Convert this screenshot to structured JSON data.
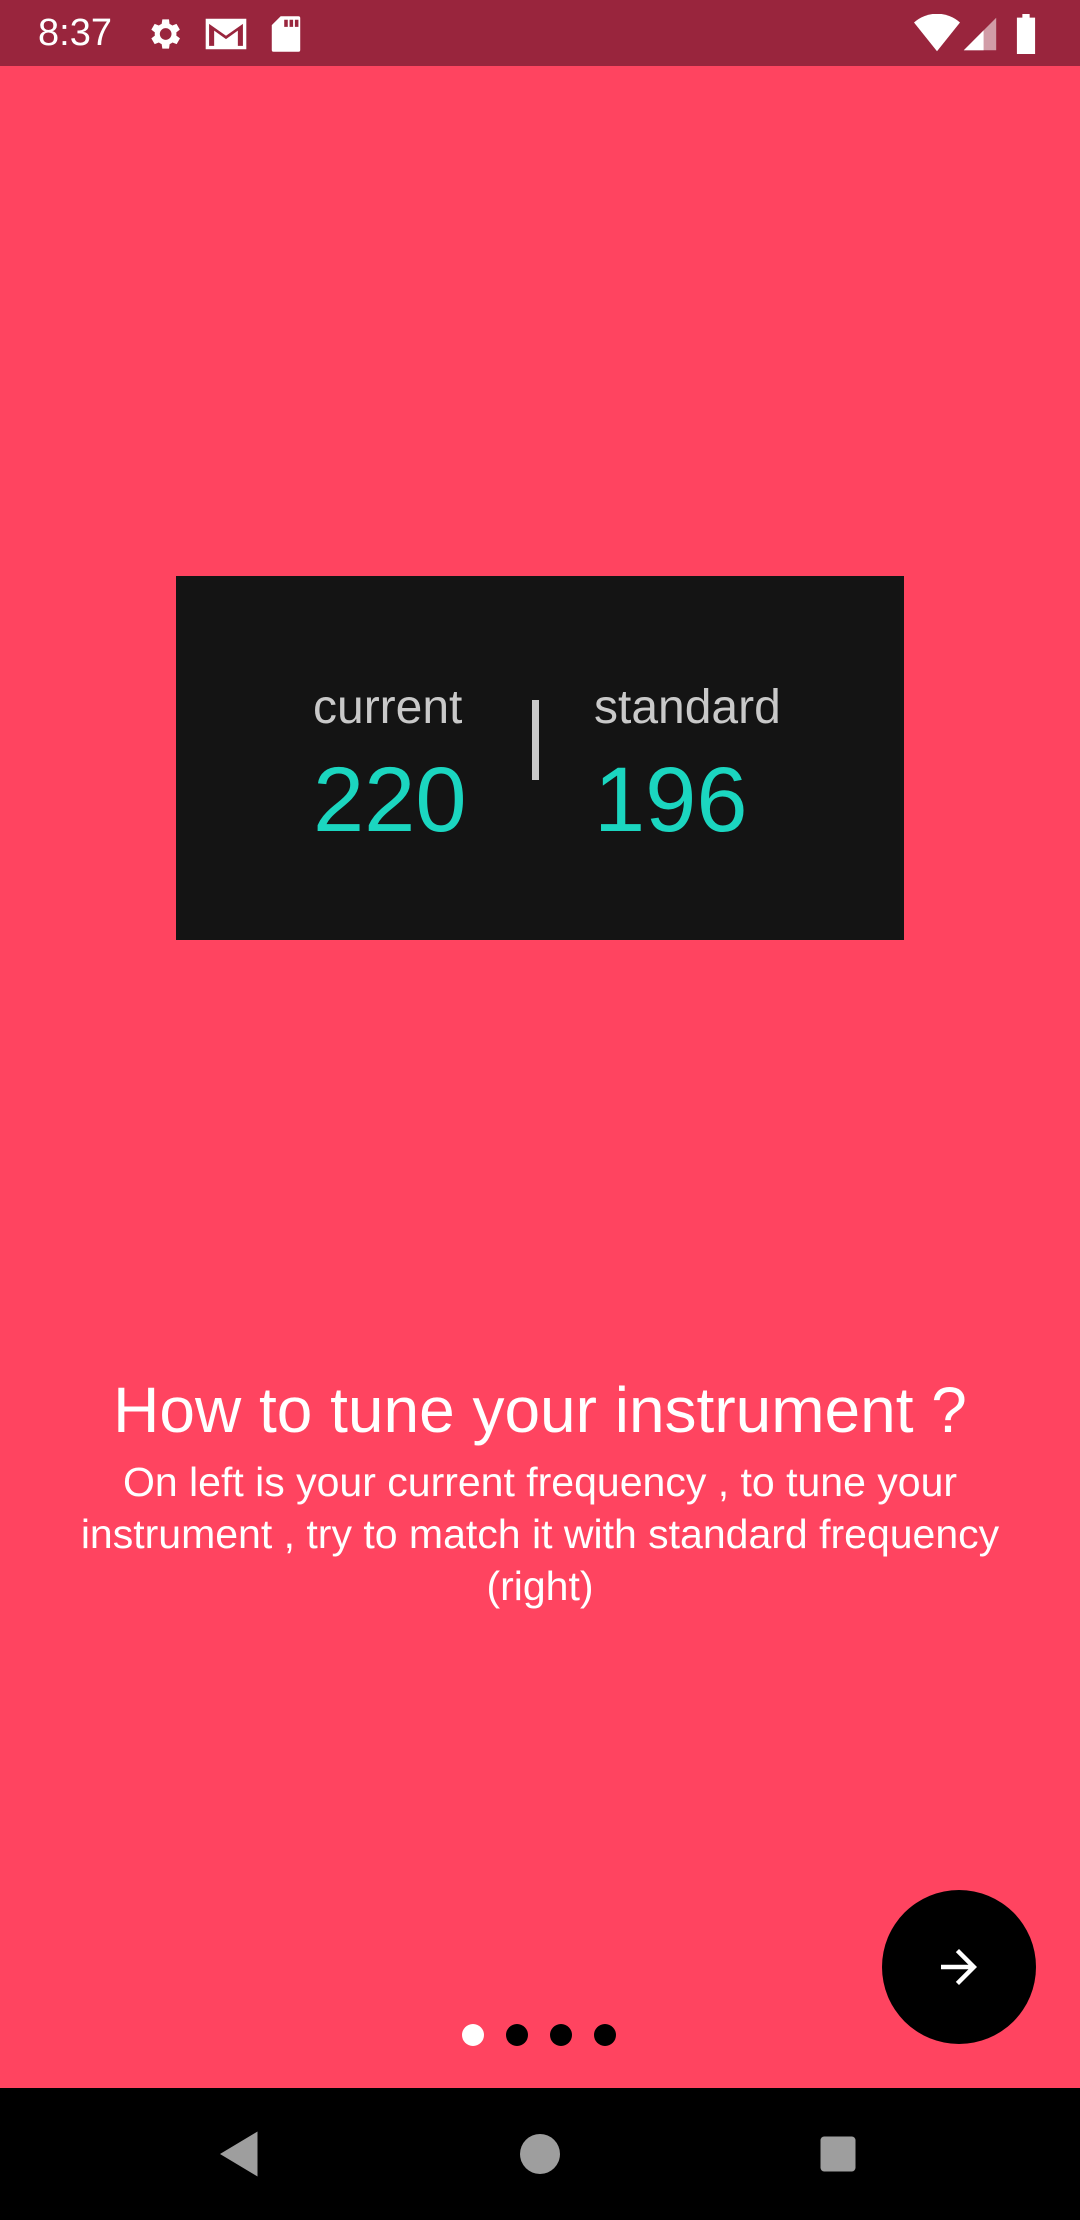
{
  "status_bar": {
    "time": "8:37",
    "icons": [
      "gear-icon",
      "gmail-icon",
      "sd-card-icon",
      "wifi-icon",
      "signal-icon",
      "battery-icon"
    ]
  },
  "preview": {
    "current_label": "current",
    "current_value": "220",
    "standard_label": "standard",
    "standard_value": "196"
  },
  "onboarding": {
    "title": "How to tune your instrument ?",
    "description": "On left is your current frequency , to tune your instrument , try to match it with standard frequency (right)",
    "pages_total": 4,
    "active_page": 1,
    "next_icon": "arrow-right-icon"
  },
  "colors": {
    "background": "#FF4460",
    "status_bar": "#99253D",
    "accent_value": "#1BD6C0",
    "card": "#141414",
    "dot_active": "#FFFFFF",
    "dot_inactive": "#000000"
  },
  "nav_bar": {
    "buttons": [
      "back-icon",
      "home-icon",
      "recents-icon"
    ]
  }
}
